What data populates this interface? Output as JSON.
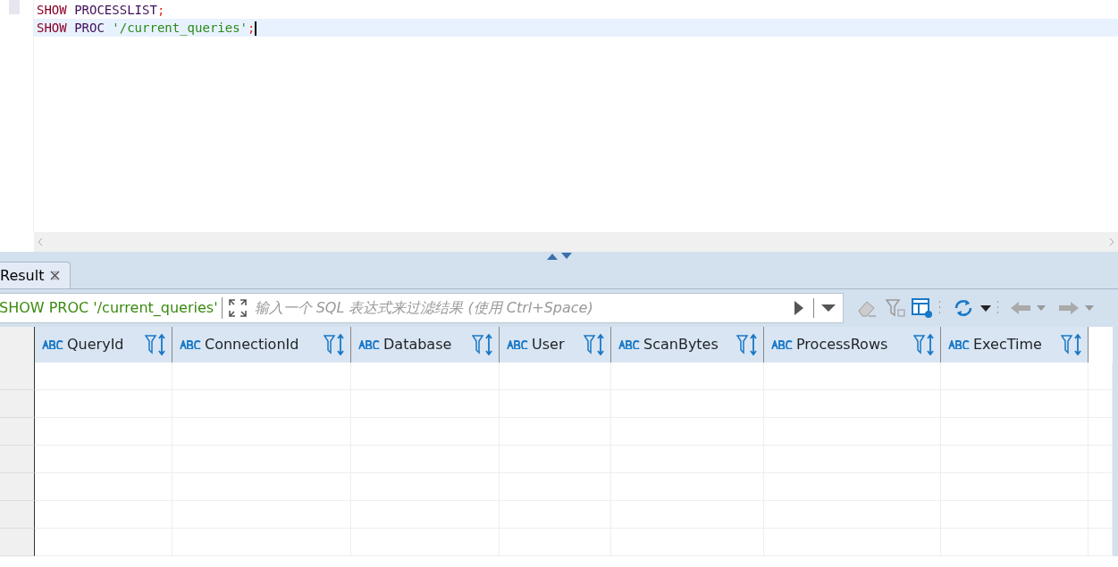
{
  "editor": {
    "lines": [
      {
        "current": false,
        "tokens": [
          {
            "kind": "keyword",
            "text": "SHOW"
          },
          {
            "kind": "ident",
            "text": "PROCESSLIST"
          },
          {
            "kind": "punct",
            "text": ";"
          }
        ]
      },
      {
        "current": true,
        "tokens": [
          {
            "kind": "keyword",
            "text": "SHOW"
          },
          {
            "kind": "ident",
            "text": "PROC"
          },
          {
            "kind": "string",
            "text": "'/current_queries'"
          },
          {
            "kind": "punct",
            "text": ";"
          }
        ]
      }
    ]
  },
  "result_tab": {
    "label": "Result",
    "selected": true
  },
  "filter_bar": {
    "query": "SHOW PROC '/current_queries'",
    "placeholder": "输入一个 SQL 表达式来过滤结果 (使用 Ctrl+Space)"
  },
  "table": {
    "columns": [
      {
        "label": "QueryId"
      },
      {
        "label": "ConnectionId"
      },
      {
        "label": "Database"
      },
      {
        "label": "User"
      },
      {
        "label": "ScanBytes"
      },
      {
        "label": "ProcessRows"
      },
      {
        "label": "ExecTime"
      }
    ]
  }
}
